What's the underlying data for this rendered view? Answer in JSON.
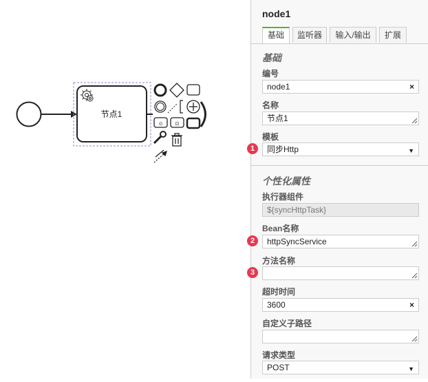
{
  "canvas": {
    "task_name": "节点1"
  },
  "panel": {
    "title": "node1",
    "tabs": [
      {
        "label": "基础",
        "active": true
      },
      {
        "label": "监听器",
        "active": false
      },
      {
        "label": "输入/输出",
        "active": false
      },
      {
        "label": "扩展",
        "active": false
      }
    ],
    "basic": {
      "heading": "基础",
      "id_label": "编号",
      "id_value": "node1",
      "name_label": "名称",
      "name_value": "节点1",
      "template_label": "模板",
      "template_value": "同步Http"
    },
    "custom": {
      "heading": "个性化属性",
      "executor_label": "执行器组件",
      "executor_value": "${syncHttpTask}",
      "bean_label": "Bean名称",
      "bean_value": "httpSyncService",
      "method_label": "方法名称",
      "method_value": "",
      "timeout_label": "超时时间",
      "timeout_value": "3600",
      "path_label": "自定义子路径",
      "path_value": "",
      "reqtype_label": "请求类型",
      "reqtype_value": "POST"
    }
  },
  "badges": [
    "1",
    "2",
    "3"
  ],
  "colors": {
    "active_tab": "#52b415",
    "badge": "#e8384f",
    "selection": "#8a8ad6"
  }
}
